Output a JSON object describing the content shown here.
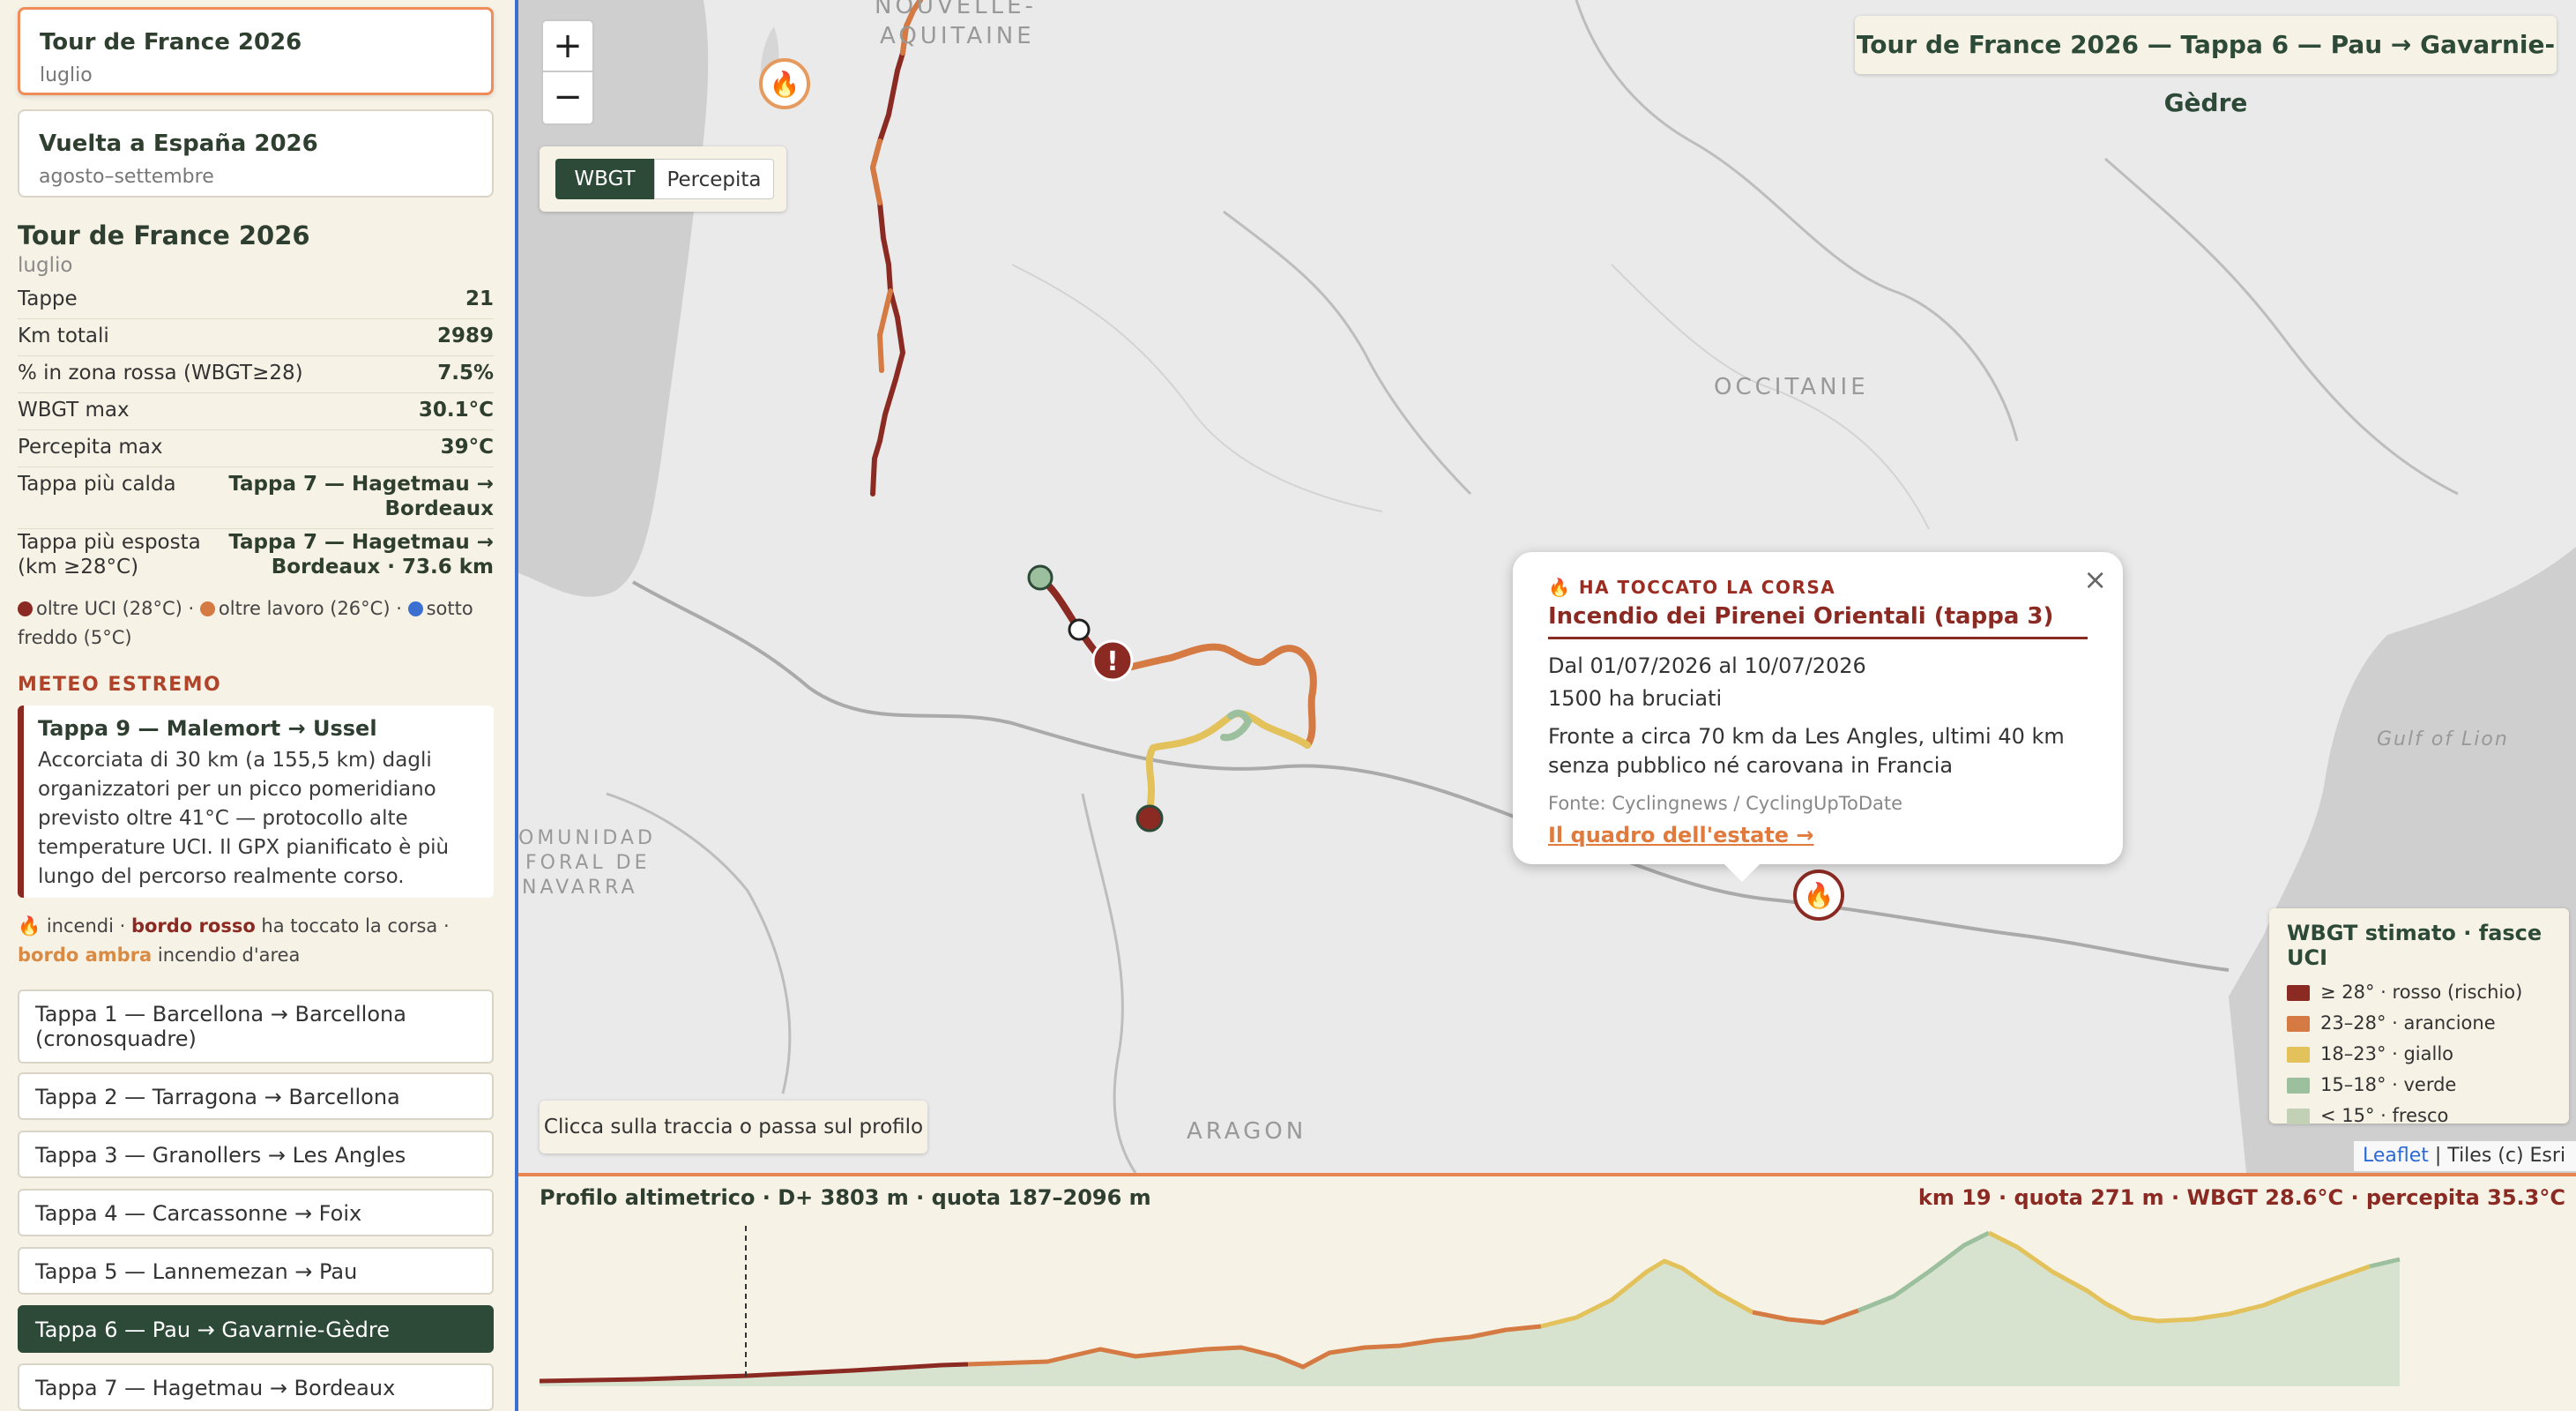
{
  "sidebar": {
    "events": [
      {
        "title": "Tour de France 2026",
        "subtitle": "luglio"
      },
      {
        "title": "Vuelta a España 2026",
        "subtitle": "agosto–settembre"
      }
    ],
    "summary": {
      "title": "Tour de France 2026",
      "subtitle": "luglio",
      "stats": [
        {
          "label": "Tappe",
          "value": "21"
        },
        {
          "label": "Km totali",
          "value": "2989"
        },
        {
          "label": "% in zona rossa (WBGT≥28)",
          "value": "7.5%"
        },
        {
          "label": "WBGT max",
          "value": "30.1°C"
        },
        {
          "label": "Percepita max",
          "value": "39°C"
        },
        {
          "label": "Tappa più calda",
          "value_line1": "Tappa 7 — Hagetmau →",
          "value_line2": "Bordeaux"
        },
        {
          "label_line1": "Tappa più esposta",
          "label_line2": "(km ≥28°C)",
          "value_line1": "Tappa 7 — Hagetmau →",
          "value_line2": "Bordeaux · 73.6 km"
        }
      ],
      "legend": {
        "red": "oltre UCI (28°C)",
        "sep1": " · ",
        "orange": "oltre lavoro (26°C)",
        "sep2": " · ",
        "blue": "sotto freddo (5°C)"
      }
    },
    "extreme": {
      "heading": "METEO ESTREMO",
      "title": "Tappa 9 — Malemort → Ussel",
      "text": "Accorciata di 30 km (a 155,5 km) dagli organizzatori per un picco pomeridiano previsto oltre 41°C — protocollo alte temperature UCI. Il GPX pianificato è più lungo del percorso realmente corso."
    },
    "fire_legend": {
      "icon": "🔥",
      "t1": " incendi · ",
      "red_bold": "bordo rosso",
      "t2": " ha toccato la corsa · ",
      "amber_bold": "bordo ambra",
      "t3": " incendio d'area"
    },
    "stages": [
      "Tappa 1 — Barcellona → Barcellona (cronosquadre)",
      "Tappa 2 — Tarragona → Barcellona",
      "Tappa 3 — Granollers → Les Angles",
      "Tappa 4 — Carcassonne → Foix",
      "Tappa 5 — Lannemezan → Pau",
      "Tappa 6 — Pau → Gavarnie-Gèdre",
      "Tappa 7 — Hagetmau → Bordeaux"
    ],
    "active_stage": 5
  },
  "map": {
    "zoom_in": "+",
    "zoom_out": "−",
    "toggle": {
      "wbgt": "WBGT",
      "perceived": "Percepita"
    },
    "title": "Tour de France 2026 — Tappa 6 — Pau → Gavarnie-Gèdre",
    "regions": {
      "nouvelle1": "NOUVELLE-",
      "nouvelle2": "AQUITAINE",
      "occitanie": "OCCITANIE",
      "navarra1": "OMUNIDAD",
      "navarra2": "FORAL DE",
      "navarra3": "NAVARRA",
      "aragon": "ARAGON",
      "gulf": "Gulf of Lion"
    },
    "hint": "Clicca sulla traccia o passa sul profilo",
    "marker_alert": "!",
    "fire_icon": "🔥",
    "popup": {
      "close": "×",
      "kicker": "🔥 HA TOCCATO LA CORSA",
      "title": "Incendio dei Pirenei Orientali (tappa 3)",
      "dates": "Dal 01/07/2026 al 10/07/2026",
      "area": "1500 ha bruciati",
      "desc": "Fronte a circa 70 km da Les Angles, ultimi 40 km senza pubblico né carovana in Francia",
      "source": "Fonte: Cyclingnews / CyclingUpToDate",
      "link": "Il quadro dell'estate →"
    },
    "legend": {
      "title": "WBGT stimato · fasce UCI",
      "items": [
        {
          "label": "≥ 28° · rosso (rischio)",
          "color": "#8b2a22"
        },
        {
          "label": "23–28° · arancione",
          "color": "#d47a42"
        },
        {
          "label": "18–23° · giallo",
          "color": "#e3c25c"
        },
        {
          "label": "15–18° · verde",
          "color": "#9cc09e"
        },
        {
          "label": "< 15° · fresco",
          "color": "#c2d1b6"
        }
      ]
    },
    "attribution": {
      "leaflet": "Leaflet",
      "tiles": " | Tiles (c) Esri"
    }
  },
  "profile": {
    "left": "Profilo altimetrico · D+ 3803 m · quota 187–2096 m",
    "right": "km 19 · quota 271 m · WBGT 28.6°C · percepita 35.3°C"
  },
  "colors": {
    "red": "#8b2a22",
    "orange": "#d47a42",
    "yellow": "#e3c25c",
    "green": "#9cc09e",
    "pale": "#c2d1b6",
    "dark_green": "#2d4a38",
    "blue": "#3b6fd0",
    "accent": "#e8844f"
  }
}
